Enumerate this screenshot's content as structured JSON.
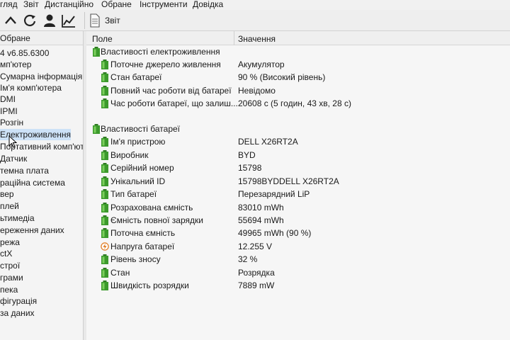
{
  "menu": {
    "items": [
      "гляд",
      "Звіт",
      "Дистанційно",
      "Обране",
      "Інструменти",
      "Довідка"
    ]
  },
  "toolbar": {
    "icons": [
      "chevron-up-icon",
      "refresh-icon",
      "user-icon",
      "chart-icon"
    ],
    "report_label": "Звіт"
  },
  "sidebar": {
    "header": "Обране",
    "items": [
      "4 v6.85.6300",
      "мп'ютер",
      "Сумарна інформація",
      "Ім'я комп'ютера",
      "DMI",
      "IPMI",
      "Розгін",
      "Електроживлення",
      "Портативний комп'ют",
      "Датчик",
      "темна плата",
      "раційна система",
      "вер",
      "плей",
      "ьтимедіа",
      "ереження даних",
      "режа",
      "ctX",
      "строї",
      "грами",
      "пека",
      "фігурація",
      "за даних"
    ],
    "selected_index": 7
  },
  "table": {
    "col_field": "Поле",
    "col_value": "Значення",
    "sections": [
      {
        "title": "Властивості електроживлення",
        "rows": [
          {
            "field": "Поточне джерело живлення",
            "value": "Акумулятор"
          },
          {
            "field": "Стан батареї",
            "value": "90 % (Високий рівень)"
          },
          {
            "field": "Повний час роботи від батареї",
            "value": "Невідомо"
          },
          {
            "field": "Час роботи батареї, що залиш...",
            "value": "20608 с (5 годин, 43 хв, 28 с)"
          }
        ]
      },
      {
        "title": "Властивості батареї",
        "rows": [
          {
            "field": "Ім'я пристрою",
            "value": "DELL X26RT2A"
          },
          {
            "field": "Виробник",
            "value": "BYD"
          },
          {
            "field": "Серійний номер",
            "value": "15798"
          },
          {
            "field": "Унікальний ID",
            "value": "15798BYDDELL X26RT2A"
          },
          {
            "field": "Тип батареї",
            "value": "Перезарядний LiP"
          },
          {
            "field": "Розрахована ємність",
            "value": "83010 mWh"
          },
          {
            "field": "Ємність повної зарядки",
            "value": "55694 mWh"
          },
          {
            "field": "Поточна ємність",
            "value": "49965 mWh  (90 %)"
          },
          {
            "field": "Напруга батареї",
            "value": "12.255 V",
            "icon": "voltage-icon"
          },
          {
            "field": "Рівень зносу",
            "value": "32 %"
          },
          {
            "field": "Стан",
            "value": "Розрядка"
          },
          {
            "field": "Швидкість розрядки",
            "value": "7889 mW"
          }
        ]
      }
    ]
  },
  "colors": {
    "battery_green": "#3c9a2c",
    "selection": "#cde2f7",
    "voltage_orange": "#e07a1f"
  }
}
